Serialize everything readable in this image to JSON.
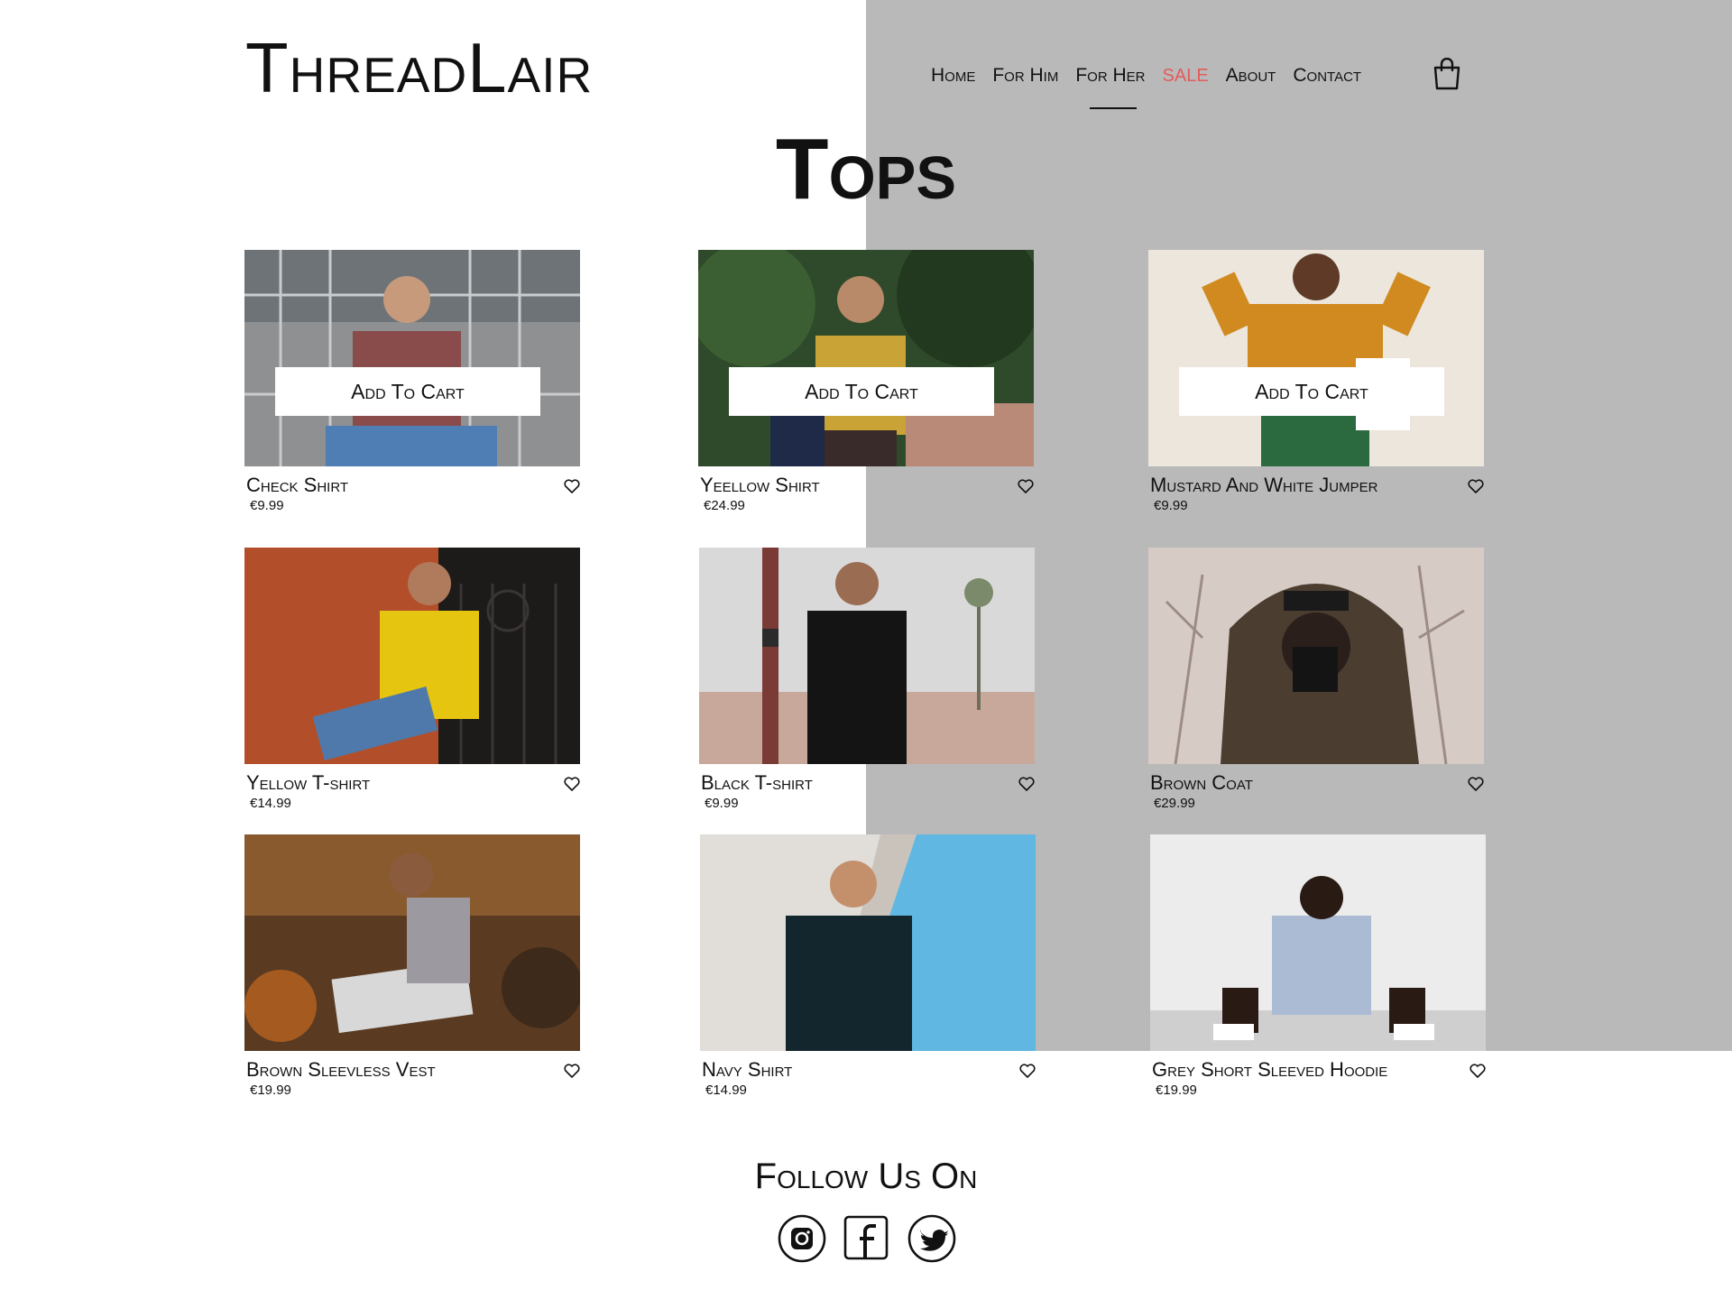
{
  "brand": {
    "logo": "ThreadLair"
  },
  "nav": {
    "items": [
      {
        "label": "Home"
      },
      {
        "label": "For Him"
      },
      {
        "label": "For Her"
      },
      {
        "label": "SALE"
      },
      {
        "label": "About"
      },
      {
        "label": "Contact"
      }
    ],
    "active": "For Her",
    "sale_color": "#e45b5b"
  },
  "page": {
    "title": "Tops"
  },
  "products": [
    {
      "name": "Check Shirt",
      "price": "€9.99",
      "cta": "Add To Cart"
    },
    {
      "name": "Yeellow Shirt",
      "price": "€24.99",
      "cta": "Add To Cart"
    },
    {
      "name": "Mustard And White Jumper",
      "price": "€9.99",
      "cta": "Add To Cart"
    },
    {
      "name": "Yellow T-shirt",
      "price": "€14.99"
    },
    {
      "name": "Black T-shirt",
      "price": "€9.99"
    },
    {
      "name": "Brown Coat",
      "price": "€29.99"
    },
    {
      "name": "Brown Sleevless Vest",
      "price": "€19.99"
    },
    {
      "name": "Navy Shirt",
      "price": "€14.99"
    },
    {
      "name": "Grey Short Sleeved Hoodie",
      "price": "€19.99"
    }
  ],
  "footer": {
    "follow_label": "Follow Us On",
    "social": [
      "instagram-icon",
      "facebook-icon",
      "twitter-icon"
    ]
  },
  "colors": {
    "background": "#ffffff",
    "panel": "#b9b9b9",
    "text": "#111111"
  }
}
